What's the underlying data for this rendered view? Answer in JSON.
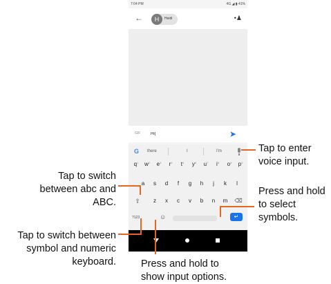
{
  "status_bar": {
    "time": "7:04 PM",
    "status": "4G ◢ ▮ 41%"
  },
  "top_bar": {
    "avatar_letter": "H",
    "contact_name": "Heidi",
    "back_icon": "back-arrow-icon",
    "people_icon": "add-people-icon"
  },
  "composer": {
    "gif_label": "GIF",
    "message_value": "Hi|",
    "send_icon": "send-icon"
  },
  "suggestions": {
    "logo": "G",
    "items": [
      "there",
      "I",
      "I'm"
    ]
  },
  "keyboard": {
    "row1": [
      "q",
      "w",
      "e",
      "r",
      "t",
      "y",
      "u",
      "i",
      "o",
      "p"
    ],
    "row1_hints": [
      "1",
      "2",
      "3",
      "4",
      "5",
      "6",
      "7",
      "8",
      "9",
      "0"
    ],
    "row2": [
      "a",
      "s",
      "d",
      "f",
      "g",
      "h",
      "j",
      "k",
      "l"
    ],
    "row3": [
      "z",
      "x",
      "c",
      "v",
      "b",
      "n",
      "m"
    ],
    "shift_icon": "⇧",
    "backspace_icon": "⌫",
    "symbols_key": "?123",
    "emoji_icon": "☺",
    "enter_icon": "↵"
  },
  "callouts": {
    "voice_input": "Tap to enter voice input.",
    "switch_abc": "Tap to switch between abc and ABC.",
    "select_symbols": "Press and hold to select symbols.",
    "switch_symbol_numeric": "Tap to switch between symbol and numeric keyboard.",
    "input_options": "Press and hold to show input options."
  },
  "colors": {
    "callout_line": "#e8661f",
    "accent": "#1a73e8"
  }
}
